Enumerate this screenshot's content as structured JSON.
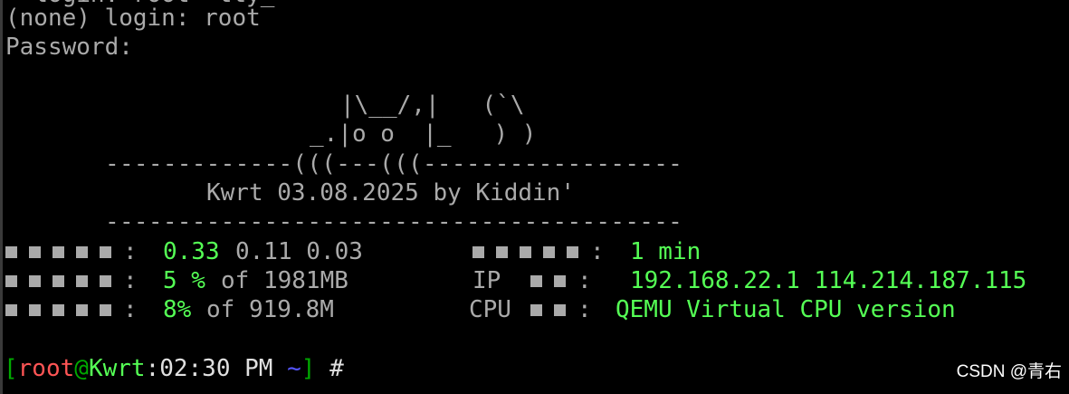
{
  "terminal": {
    "cut_line": "  login: root  tty_",
    "login_line": "(none) login: root",
    "password_line": "Password:",
    "banner": {
      "art_line1": "|\\__/,|   (`\\",
      "art_line2": "_.|o o  |_   ) )",
      "rule_top": "-------------(((---(((------------------",
      "title": "Kwrt 03.08.2025 by Kiddin'",
      "rule_bottom": "----------------------------------------"
    },
    "info": {
      "load_sep": ":",
      "load_value": "0.33",
      "load_rest": "0.11 0.03",
      "uptime_sep": ":",
      "uptime_value": "1 min",
      "mem_sep": ":",
      "mem_value": "5 %",
      "mem_rest": "of 1981MB",
      "ip_label": "IP",
      "ip_sep": ":",
      "ip_value": "192.168.22.1 114.214.187.115",
      "disk_sep": ":",
      "disk_value": "8%",
      "disk_rest": "of 919.8M",
      "cpu_label": "CPU",
      "cpu_sep": ":",
      "cpu_value": "QEMU Virtual CPU version"
    },
    "prompt": {
      "open_bracket": "[",
      "user": "root",
      "at": "@",
      "host": "Kwrt",
      "time": ":02:30 PM",
      "dir": "~",
      "close_bracket": "]",
      "symbol": "#"
    }
  },
  "watermark": "CSDN @青右",
  "colors": {
    "background": "#000000",
    "text": "#aaaaaa",
    "bright_green": "#55ff55",
    "green": "#00aa00",
    "red": "#ff5555",
    "blue": "#5555ff"
  }
}
